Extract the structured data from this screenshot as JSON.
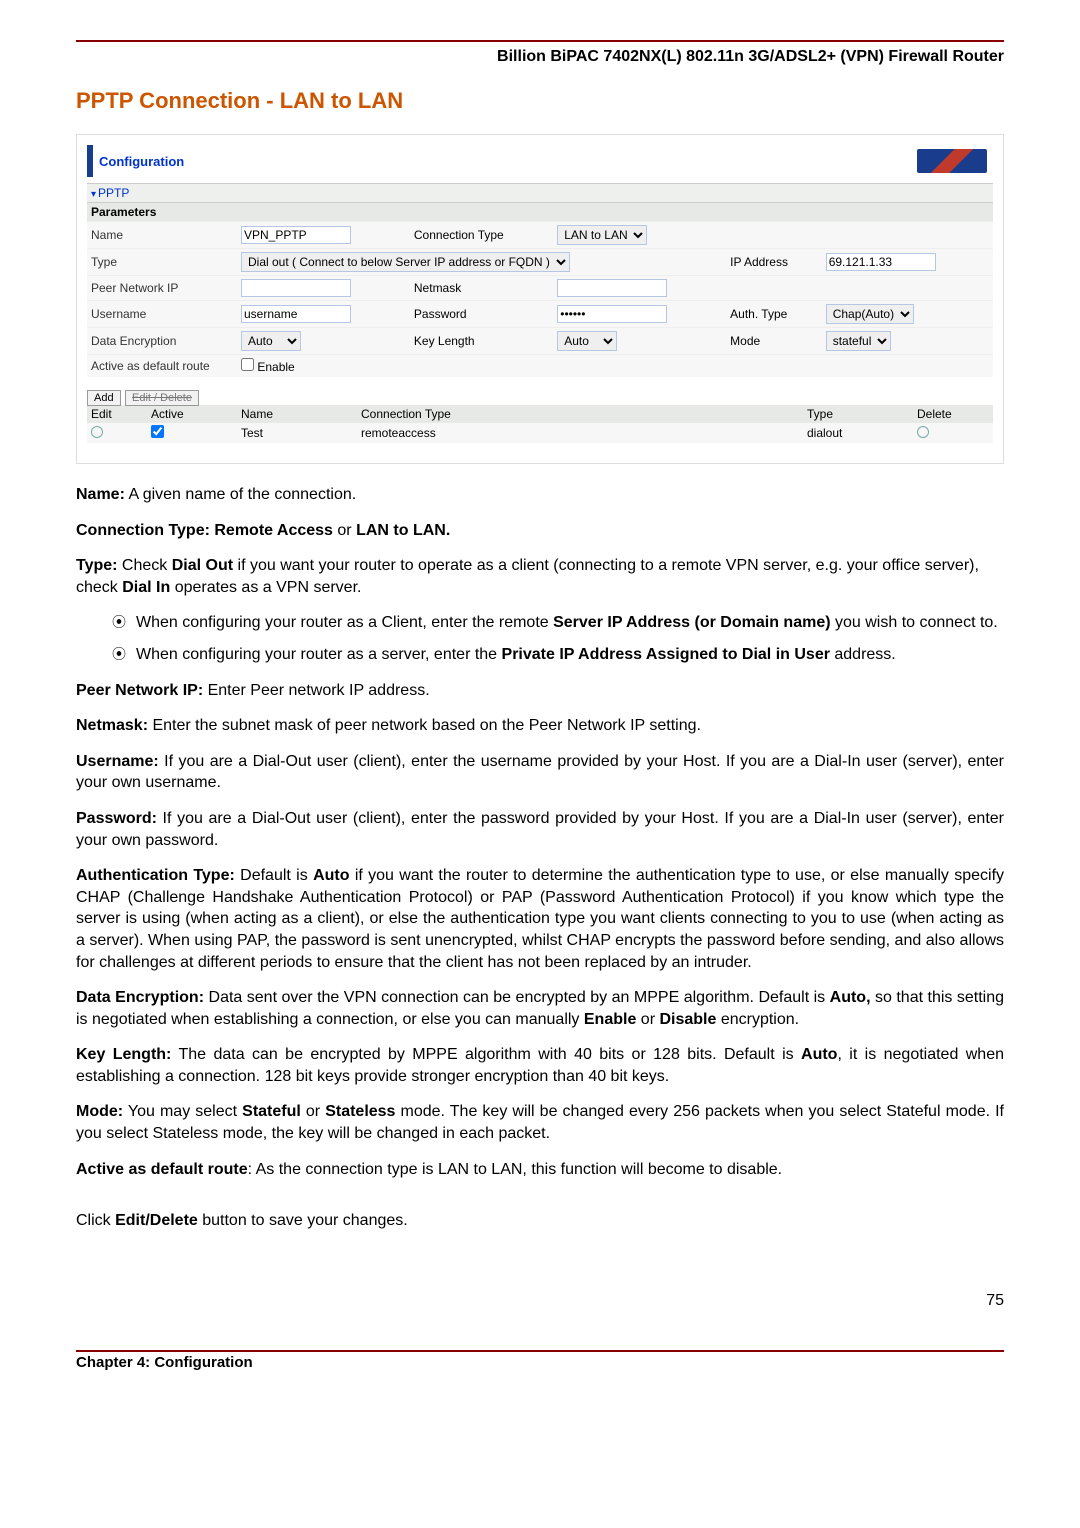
{
  "doc": {
    "product_title": "Billion BiPAC 7402NX(L) 802.11n 3G/ADSL2+ (VPN) Firewall Router",
    "section_title": "PPTP Connection - LAN to LAN",
    "chapter": "Chapter 4: Configuration",
    "page_number": "75"
  },
  "panel": {
    "configuration_label": "Configuration",
    "pptp_label": "PPTP",
    "parameters_label": "Parameters",
    "name": {
      "label": "Name",
      "value": "VPN_PPTP"
    },
    "connection_type": {
      "label": "Connection Type",
      "value": "LAN to LAN"
    },
    "type": {
      "label": "Type",
      "value": "Dial out ( Connect to below Server IP address or FQDN )"
    },
    "ip_address": {
      "label": "IP Address",
      "value": "69.121.1.33"
    },
    "peer_network_ip": {
      "label": "Peer Network IP",
      "value": ""
    },
    "netmask": {
      "label": "Netmask",
      "value": ""
    },
    "username": {
      "label": "Username",
      "value": "username"
    },
    "password": {
      "label": "Password",
      "value": "••••••"
    },
    "auth_type": {
      "label": "Auth. Type",
      "value": "Chap(Auto)"
    },
    "data_encryption": {
      "label": "Data Encryption",
      "value": "Auto"
    },
    "key_length": {
      "label": "Key Length",
      "value": "Auto"
    },
    "mode": {
      "label": "Mode",
      "value": "stateful"
    },
    "active_default": {
      "label": "Active as default route",
      "enable_label": "Enable"
    },
    "tabs": {
      "add": "Add",
      "edit_delete": "Edit / Delete"
    },
    "list": {
      "headers": {
        "edit": "Edit",
        "active": "Active",
        "name": "Name",
        "connection_type": "Connection Type",
        "type": "Type",
        "delete": "Delete"
      },
      "row": {
        "name": "Test",
        "connection_type": "remoteaccess",
        "type": "dialout"
      }
    }
  },
  "body": {
    "p_name": {
      "b": "Name:",
      "t": " A given name of the connection."
    },
    "p_conntype": {
      "b1": "Connection Type: Remote Access",
      "t1": " or ",
      "b2": "LAN to LAN."
    },
    "p_type": {
      "b1": "Type:",
      "t1": " Check ",
      "b2": "Dial Out",
      "t2": " if you want your router to operate as a client (connecting to a remote VPN server, e.g. your office server), check ",
      "b3": "Dial In",
      "t3": " operates as a VPN server."
    },
    "li1": {
      "t1": "When configuring your router as a Client, enter the remote ",
      "b1": "Server IP Address (or Domain name)",
      "t2": " you wish to connect to."
    },
    "li2": {
      "t1": "When configuring your router as a server, enter the ",
      "b1": "Private IP Address Assigned to Dial in User",
      "t2": " address."
    },
    "p_peer": {
      "b": "Peer Network IP:",
      "t": " Enter Peer network IP address."
    },
    "p_netmask": {
      "b": "Netmask:",
      "t": " Enter the subnet mask of peer network based on the Peer Network IP setting."
    },
    "p_username": {
      "b": "Username:",
      "t": " If you are a Dial-Out user (client), enter the username provided by your Host.   If you are a Dial-In user (server), enter your own username."
    },
    "p_password": {
      "b": "Password:",
      "t": " If you are a Dial-Out user (client), enter the password provided by your Host. If you are a Dial-In user (server), enter your own password."
    },
    "p_auth": {
      "b1": "Authentication Type:",
      "t1": " Default is ",
      "b2": "Auto",
      "t2": " if you want the router to determine the authentication type to use, or else manually specify CHAP (Challenge Handshake Authentication Protocol) or PAP (Password Authentication Protocol) if you know which type the server is using (when acting as a client), or else the authentication type you want clients connecting to you to use (when acting as a server). When using PAP, the password is sent unencrypted, whilst CHAP encrypts the password before sending, and also allows for challenges at different periods to ensure that the client has not been replaced by an intruder."
    },
    "p_dataenc": {
      "b1": "Data Encryption:",
      "t1": " Data sent over the VPN connection can be encrypted by an MPPE algorithm. Default is ",
      "b2": "Auto,",
      "t2": " so that this setting is negotiated when establishing a connection, or else you can manually ",
      "b3": "Enable",
      "t3": " or ",
      "b4": "Disable",
      "t4": " encryption."
    },
    "p_keylen": {
      "b1": "Key Length:",
      "t1": " The data can be encrypted by MPPE algorithm with 40 bits or 128 bits. Default is ",
      "b2": "Auto",
      "t2": ", it is negotiated when establishing a connection. 128 bit keys provide stronger encryption than 40 bit keys."
    },
    "p_mode": {
      "b1": "Mode:",
      "t1": " You may select ",
      "b2": "Stateful",
      "t2": " or ",
      "b3": "Stateless",
      "t3": " mode. The key will be changed every 256 packets when you select Stateful mode. If you select Stateless mode, the key will be changed in each packet."
    },
    "p_activedef": {
      "b": "Active as default route",
      "t": ": As the connection type is LAN to LAN, this function will become to disable."
    },
    "p_click": {
      "t1": "Click ",
      "b1": "Edit/Delete",
      "t2": " button to save your changes."
    }
  }
}
